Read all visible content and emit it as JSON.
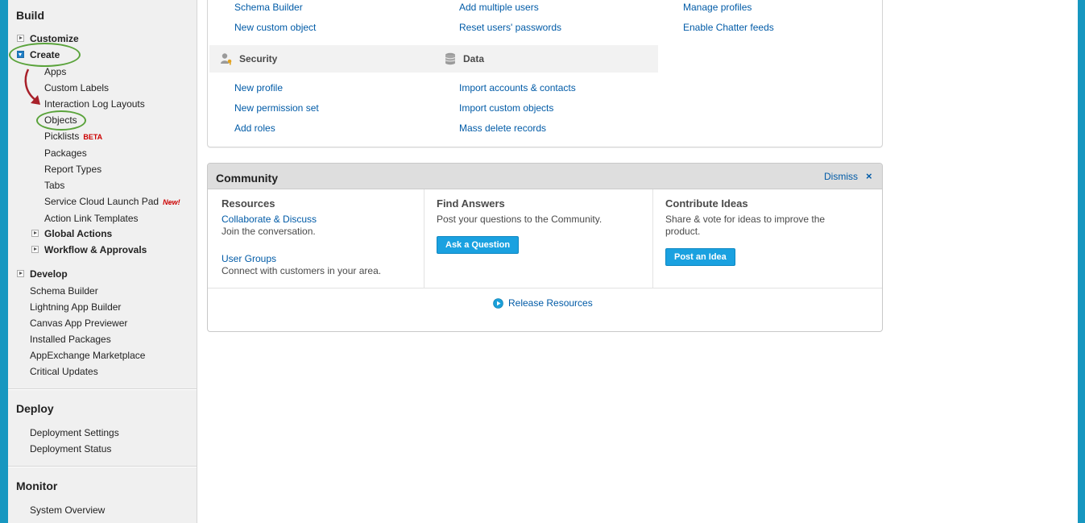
{
  "sidebar": {
    "build": {
      "title": "Build",
      "customize": "Customize",
      "create": "Create",
      "create_items": [
        "Apps",
        "Custom Labels",
        "Interaction Log Layouts",
        "Objects",
        "Picklists",
        "Packages",
        "Report Types",
        "Tabs",
        "Service Cloud Launch Pad",
        "Action Link Templates"
      ],
      "picklists_badge": "BETA",
      "launchpad_badge": "New!",
      "global_actions": "Global Actions",
      "workflow": "Workflow & Approvals",
      "develop": "Develop",
      "develop_items": [
        "Schema Builder",
        "Lightning App Builder",
        "Canvas App Previewer",
        "Installed Packages",
        "AppExchange Marketplace",
        "Critical Updates"
      ]
    },
    "deploy": {
      "title": "Deploy",
      "items": [
        "Deployment Settings",
        "Deployment Status"
      ]
    },
    "monitor": {
      "title": "Monitor",
      "items": [
        "System Overview"
      ]
    }
  },
  "top_panel": {
    "row1": [
      "Schema Builder",
      "Add multiple users",
      "Manage profiles"
    ],
    "row2": [
      "New custom object",
      "Reset users' passwords",
      "Enable Chatter feeds"
    ],
    "security": {
      "title": "Security",
      "icon": "key-user-icon",
      "links": [
        "New profile",
        "New permission set",
        "Add roles"
      ]
    },
    "data": {
      "title": "Data",
      "icon": "database-icon",
      "links": [
        "Import accounts & contacts",
        "Import custom objects",
        "Mass delete records"
      ]
    }
  },
  "community": {
    "title": "Community",
    "dismiss": "Dismiss",
    "resources": {
      "title": "Resources",
      "link1": "Collaborate & Discuss",
      "text1": "Join the conversation.",
      "link2": "User Groups",
      "text2": "Connect with customers in your area."
    },
    "find_answers": {
      "title": "Find Answers",
      "text": "Post your questions to the Community.",
      "button": "Ask a Question"
    },
    "contribute": {
      "title": "Contribute Ideas",
      "text": "Share & vote for ideas to improve the product.",
      "button": "Post an Idea"
    },
    "release": "Release Resources"
  },
  "colors": {
    "frame": "#1797c0",
    "link": "#015ba7",
    "annotation_ring": "#5aa33b",
    "annotation_arrow": "#a8202a",
    "button": "#1aa1e0"
  }
}
